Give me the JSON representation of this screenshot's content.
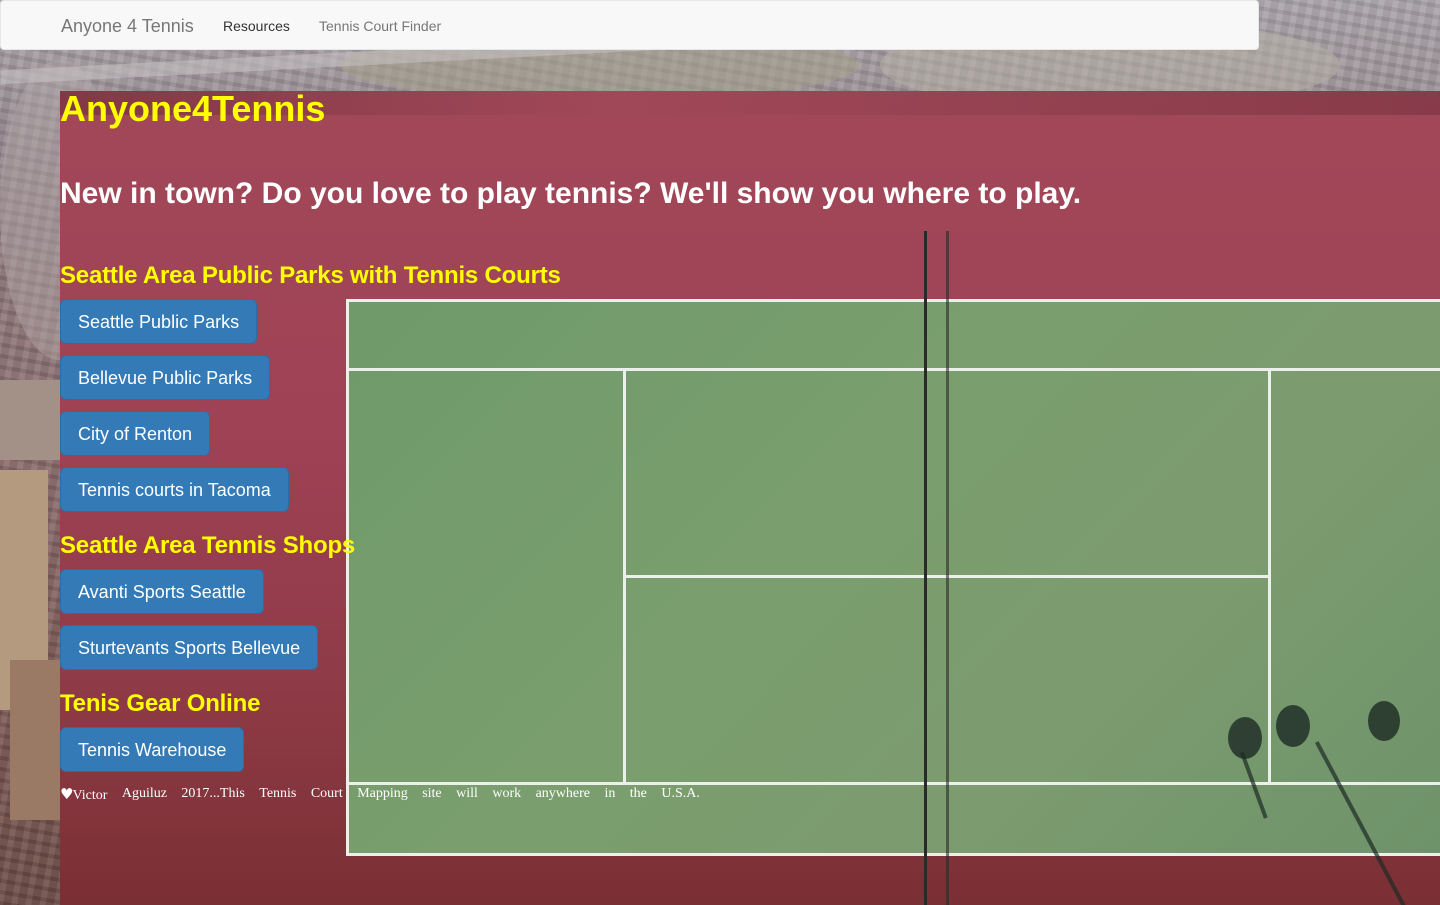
{
  "navbar": {
    "brand": "Anyone 4 Tennis",
    "links": [
      {
        "label": "Resources",
        "active": true
      },
      {
        "label": "Tennis Court Finder",
        "active": false
      }
    ]
  },
  "main": {
    "title": "Anyone4Tennis",
    "tagline": "New in town? Do you love to play tennis? We'll show you where to play.",
    "sections": [
      {
        "heading": "Seattle Area Public Parks with Tennis Courts",
        "buttons": [
          "Seattle Public Parks",
          "Bellevue Public Parks",
          "City of Renton",
          "Tennis courts in Tacoma"
        ]
      },
      {
        "heading": "Seattle Area Tennis Shops",
        "buttons": [
          "Avanti Sports Seattle",
          "Sturtevants Sports Bellevue"
        ]
      },
      {
        "heading": "Tenis Gear Online",
        "buttons": [
          "Tennis Warehouse"
        ]
      }
    ]
  },
  "footer": {
    "icon": "heart-icon",
    "words": [
      "Victor",
      "Aguiluz",
      "2017...This",
      "Tennis",
      "Court",
      "Mapping",
      "site",
      "will",
      "work",
      "anywhere",
      "in",
      "the",
      "U.S.A."
    ]
  },
  "colors": {
    "heading_yellow": "#ffff00",
    "button_blue": "#337ab7",
    "navbar_bg": "#f8f8f8",
    "court_red": "#a14858",
    "court_green": "#7a9e6e"
  }
}
